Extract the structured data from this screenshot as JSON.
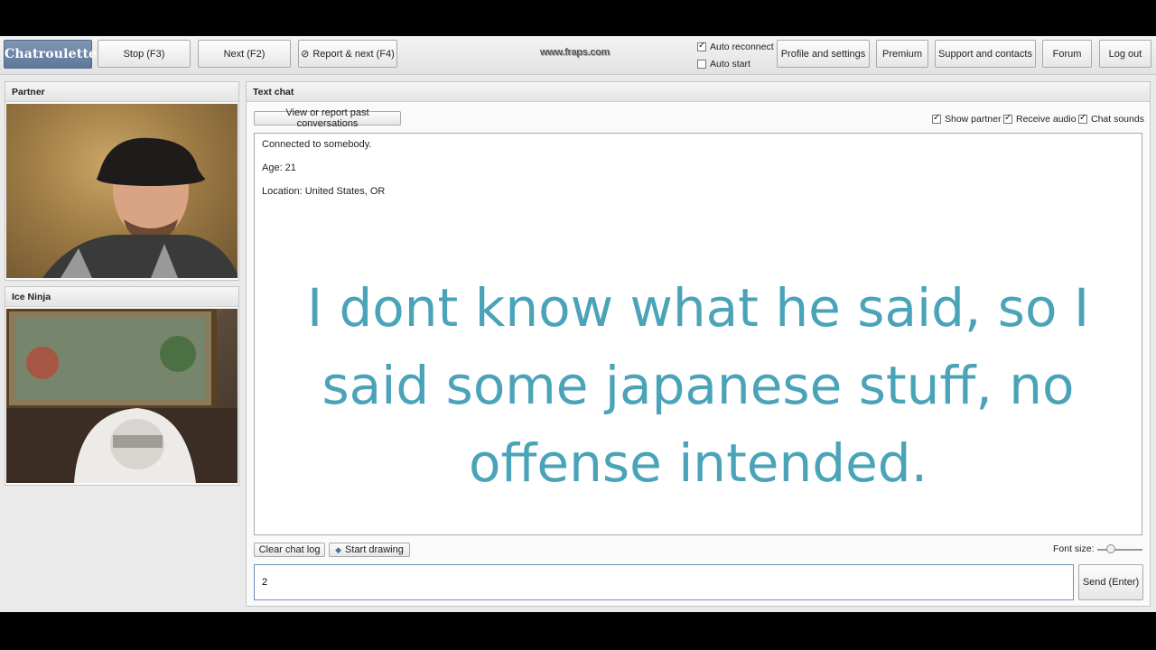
{
  "app": {
    "logo": "Chatroulette",
    "watermark": "www.fraps.com"
  },
  "toolbar": {
    "stop": "Stop (F3)",
    "next": "Next (F2)",
    "report_next": "Report & next (F4)",
    "auto_reconnect": {
      "label": "Auto reconnect",
      "checked": true
    },
    "auto_start": {
      "label": "Auto start",
      "checked": false
    },
    "profile": "Profile and settings",
    "premium": "Premium",
    "support": "Support and contacts",
    "forum": "Forum",
    "logout": "Log out"
  },
  "partner_panel": {
    "title": "Partner"
  },
  "self_panel": {
    "title": "Ice Ninja"
  },
  "chat": {
    "title": "Text chat",
    "view_past": "View or report past conversations",
    "show_partner": {
      "label": "Show partner",
      "checked": true
    },
    "receive_audio": {
      "label": "Receive audio",
      "checked": true
    },
    "chat_sounds": {
      "label": "Chat sounds",
      "checked": true
    },
    "lines": [
      "Connected to somebody.",
      "Age: 21",
      "Location: United States, OR"
    ],
    "overlay_caption": "I dont know what he said, so I said some japanese stuff, no offense intended.",
    "clear_log": "Clear chat log",
    "start_drawing": "Start drawing",
    "font_size_label": "Font size:",
    "font_size_level": 0.25,
    "input_value": "2",
    "send": "Send (Enter)"
  },
  "colors": {
    "logo_bg": "#6f87a8",
    "overlay_text": "#4aa3b8",
    "input_border": "#6e8eb6"
  }
}
